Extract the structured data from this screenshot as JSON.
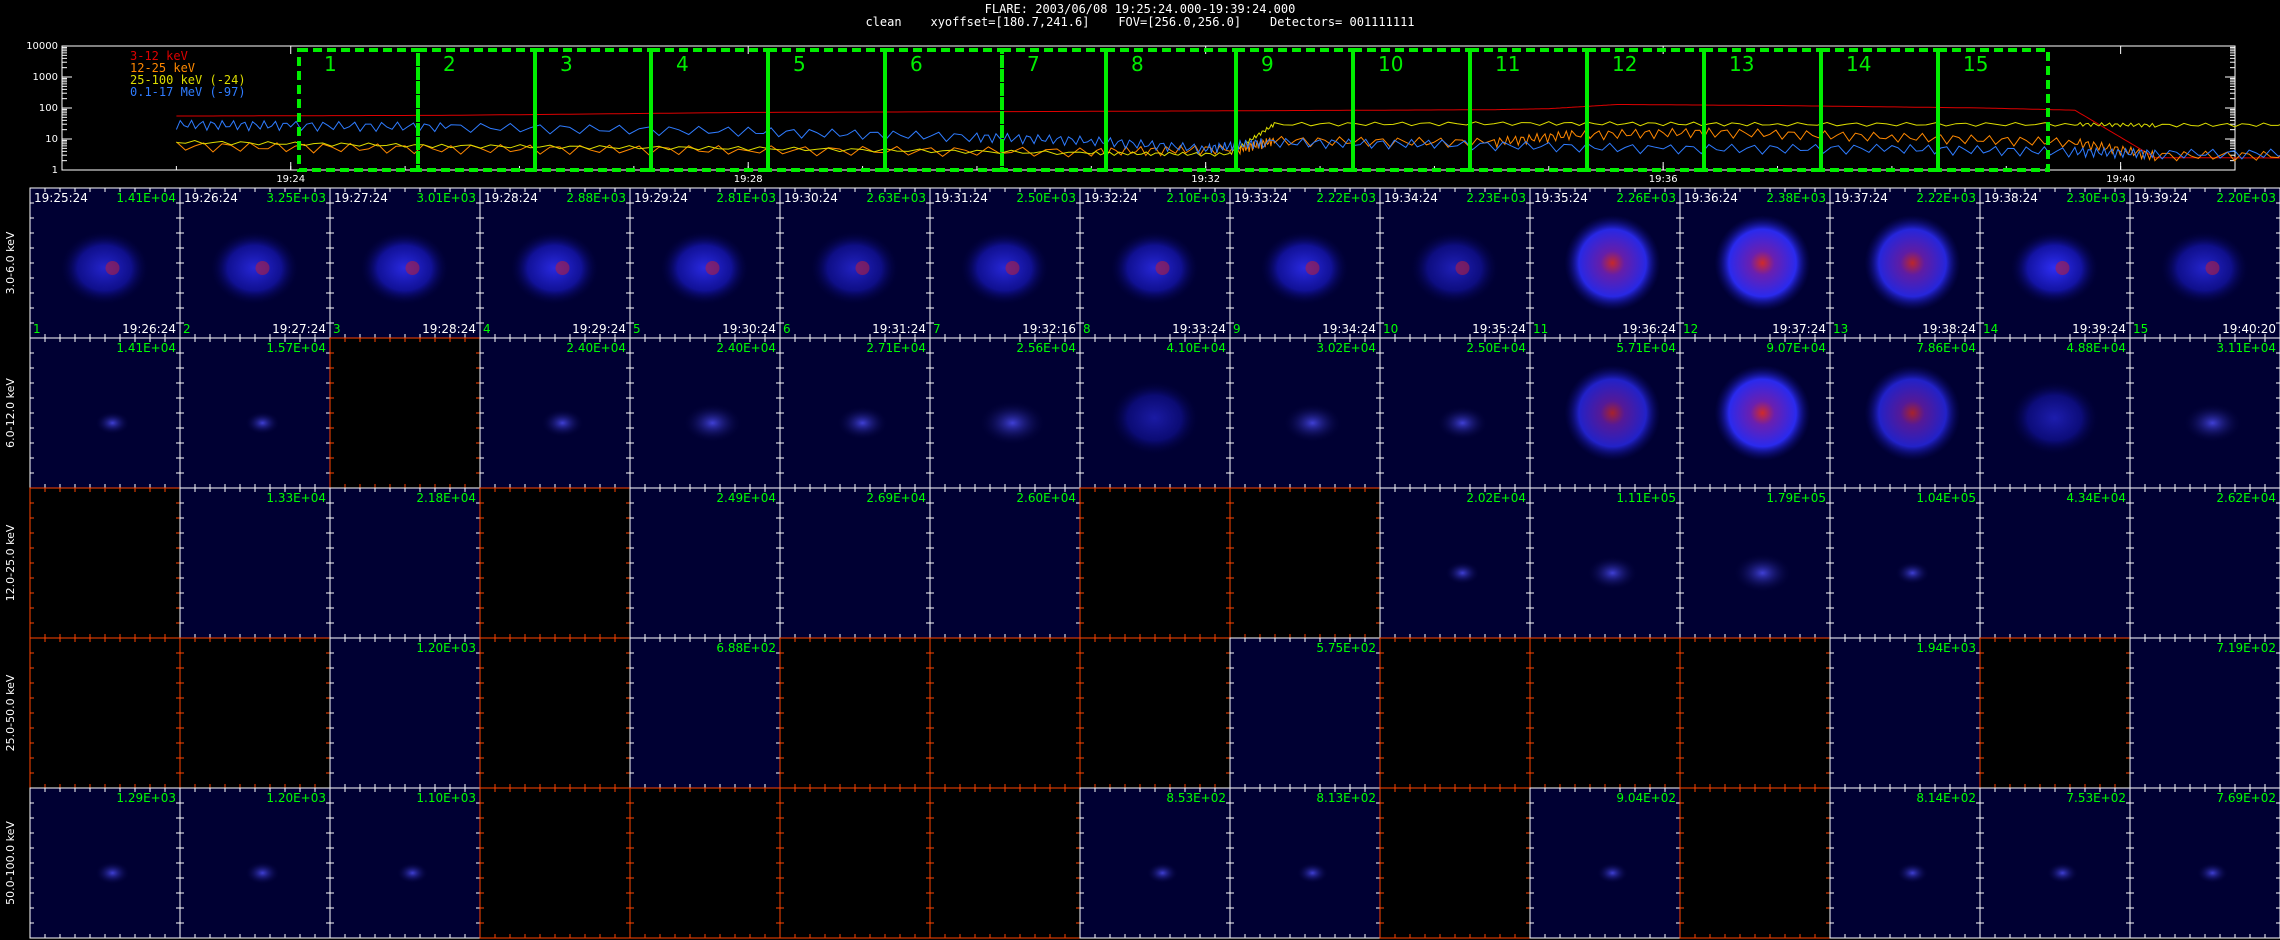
{
  "header": {
    "line1": "FLARE: 2003/06/08 19:25:24.000-19:39:24.000",
    "line2": "clean    xyoffset=[180.7,241.6]    FOV=[256.0,256.0]    Detectors= 001111111"
  },
  "chart_data": [
    {
      "type": "line",
      "title": "",
      "yscale": "log",
      "ylim": [
        1,
        10000
      ],
      "xlim_minutes": [
        19.366,
        19.683
      ],
      "x_tick_labels": [
        "19:24",
        "19:28",
        "19:32",
        "19:36",
        "19:40"
      ],
      "y_tick_labels": [
        "10000",
        "1000",
        "100",
        "10",
        "1"
      ],
      "x_unit": "minute of day (hour 19 = 19:mm)",
      "legend": "top-left",
      "series": [
        {
          "name": "3-12 keV",
          "color": "#dd0000",
          "x": [
            23.0,
            25.4,
            28.0,
            31.0,
            32.5,
            34.5,
            35.0,
            35.6,
            37.0,
            38.8,
            39.6,
            40.3,
            42.2
          ],
          "y": [
            55,
            58,
            72,
            78,
            82,
            88,
            95,
            130,
            120,
            100,
            85,
            2.5,
            2.4
          ]
        },
        {
          "name": "12-25 keV",
          "color": "#ff8800",
          "x": [
            23.0,
            25.4,
            28.0,
            31.0,
            32.3,
            32.6,
            34.5,
            35.2,
            36.4,
            38.0,
            39.6,
            40.3,
            42.2
          ],
          "y": [
            6,
            5,
            4.5,
            4,
            5,
            9,
            8,
            14,
            17,
            12,
            8,
            3,
            3
          ]
        },
        {
          "name": "25-100 keV (-24)",
          "color": "#dddd00",
          "x": [
            23.0,
            25.4,
            28.0,
            31.0,
            32.2,
            32.6,
            35.0,
            37.0,
            39.6,
            40.3,
            42.2
          ],
          "y": [
            8,
            6,
            5,
            3.5,
            3.2,
            30,
            32,
            30,
            30,
            28,
            30
          ]
        },
        {
          "name": "0.1-17 MeV (-97)",
          "color": "#2f7cff",
          "x": [
            23.0,
            24.0,
            25.4,
            28.0,
            30.0,
            31.0,
            32.0,
            32.5,
            34.0,
            36.0,
            38.0,
            39.6,
            40.3,
            42.2
          ],
          "y": [
            30,
            28,
            25,
            18,
            12,
            9,
            5,
            8,
            7,
            5,
            5,
            4,
            3.5,
            3.5
          ]
        }
      ],
      "intervals": [
        "1",
        "2",
        "3",
        "4",
        "5",
        "6",
        "7",
        "8",
        "9",
        "10",
        "11",
        "12",
        "13",
        "14",
        "15"
      ]
    },
    {
      "type": "image_grid",
      "title": "",
      "rows": [
        {
          "label": "3.0-6.0 keV",
          "valid": [
            1,
            1,
            1,
            1,
            1,
            1,
            1,
            1,
            1,
            1,
            1,
            1,
            1,
            1,
            1
          ],
          "max": [
            "1.41E+04",
            "3.25E+03",
            "3.01E+03",
            "2.88E+03",
            "2.81E+03",
            "2.63E+03",
            "2.50E+03",
            "2.10E+03",
            "2.22E+03",
            "2.23E+03",
            "2.26E+03",
            "2.38E+03",
            "2.22E+03",
            "2.30E+03",
            "2.20E+03"
          ],
          "intensity": [
            0.5,
            0.55,
            0.6,
            0.6,
            0.6,
            0.45,
            0.55,
            0.55,
            0.6,
            0.4,
            0.95,
            1.0,
            0.9,
            0.7,
            0.5
          ],
          "start_times": [
            "19:25:24",
            "19:26:24",
            "19:27:24",
            "19:28:24",
            "19:29:24",
            "19:30:24",
            "19:31:24",
            "19:32:24",
            "19:33:24",
            "19:34:24",
            "19:35:24",
            "19:36:24",
            "19:37:24",
            "19:38:24",
            "19:39:24"
          ],
          "end_times": [
            "19:26:24",
            "19:27:24",
            "19:28:24",
            "19:29:24",
            "19:30:24",
            "19:31:24",
            "19:32:16",
            "19:33:24",
            "19:34:24",
            "19:35:24",
            "19:36:24",
            "19:37:24",
            "19:38:24",
            "19:39:24",
            "19:40:20"
          ],
          "interval_numbers": [
            "1",
            "2",
            "3",
            "4",
            "5",
            "6",
            "7",
            "8",
            "9",
            "10",
            "11",
            "12",
            "13",
            "14",
            "15"
          ]
        },
        {
          "label": "6.0-12.0 keV",
          "valid": [
            1,
            1,
            0,
            1,
            1,
            1,
            1,
            1,
            1,
            1,
            1,
            1,
            1,
            1,
            1
          ],
          "max": [
            "1.41E+04",
            "1.57E+04",
            "",
            "2.40E+04",
            "2.40E+04",
            "2.71E+04",
            "2.56E+04",
            "4.10E+04",
            "3.02E+04",
            "2.50E+04",
            "5.71E+04",
            "9.07E+04",
            "7.86E+04",
            "4.88E+04",
            "3.11E+04"
          ],
          "intensity": [
            0.05,
            0.05,
            0,
            0.1,
            0.2,
            0.15,
            0.25,
            0.3,
            0.2,
            0.15,
            0.8,
            1.0,
            0.8,
            0.35,
            0.2
          ]
        },
        {
          "label": "12.0-25.0 keV",
          "valid": [
            0,
            1,
            1,
            0,
            1,
            1,
            1,
            0,
            0,
            1,
            1,
            1,
            1,
            1,
            1
          ],
          "max": [
            "",
            "1.33E+04",
            "2.18E+04",
            "",
            "2.49E+04",
            "2.69E+04",
            "2.60E+04",
            "",
            "",
            "2.02E+04",
            "1.11E+05",
            "1.79E+05",
            "1.04E+05",
            "4.34E+04",
            "2.62E+04"
          ],
          "intensity": [
            0,
            0,
            0,
            0,
            0,
            0,
            0,
            0,
            0,
            0.05,
            0.15,
            0.2,
            0.05,
            0,
            0
          ]
        },
        {
          "label": "25.0-50.0 keV",
          "valid": [
            0,
            0,
            1,
            0,
            1,
            0,
            0,
            0,
            1,
            0,
            0,
            0,
            1,
            0,
            1
          ],
          "max": [
            "",
            "",
            "1.20E+03",
            "",
            "6.88E+02",
            "",
            "",
            "",
            "5.75E+02",
            "",
            "",
            "",
            "1.94E+03",
            "",
            "7.19E+02"
          ],
          "intensity": [
            0,
            0,
            0,
            0,
            0,
            0,
            0,
            0,
            0,
            0,
            0,
            0,
            0,
            0,
            0
          ]
        },
        {
          "label": "50.0-100.0 keV",
          "valid": [
            1,
            1,
            1,
            0,
            0,
            0,
            0,
            1,
            1,
            0,
            1,
            0,
            1,
            1,
            1
          ],
          "max": [
            "1.29E+03",
            "1.20E+03",
            "1.10E+03",
            "",
            "",
            "",
            "",
            "8.53E+02",
            "8.13E+02",
            "",
            "9.04E+02",
            "",
            "8.14E+02",
            "7.53E+02",
            "7.69E+02"
          ],
          "intensity": [
            0.05,
            0.05,
            0.03,
            0,
            0,
            0,
            0,
            0.03,
            0.03,
            0,
            0.03,
            0,
            0.03,
            0.03,
            0.03
          ]
        }
      ]
    }
  ],
  "colors": {
    "interval_box": "#00ee00",
    "max_value": "#00ff00",
    "image_frame_valid": "#ffffff",
    "image_frame_invalid": "#ff4400",
    "image_bg": "#000033",
    "source": "#3333ff",
    "core": "#cc2222"
  }
}
